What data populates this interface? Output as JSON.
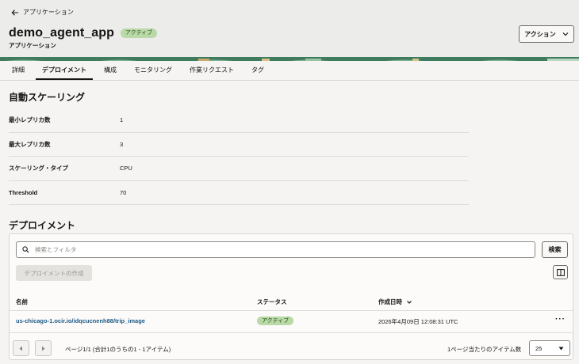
{
  "header": {
    "back_label": "アプリケーション",
    "title": "demo_agent_app",
    "status": "アクティブ",
    "subtitle": "アプリケーション",
    "action_label": "アクション"
  },
  "tabs": [
    {
      "label": "詳細"
    },
    {
      "label": "デプロイメント",
      "active": true
    },
    {
      "label": "構成"
    },
    {
      "label": "モニタリング"
    },
    {
      "label": "作業リクエスト"
    },
    {
      "label": "タグ"
    }
  ],
  "autoscaling": {
    "title": "自動スケーリング",
    "rows": [
      {
        "key": "最小レプリカ数",
        "value": "1"
      },
      {
        "key": "最大レプリカ数",
        "value": "3"
      },
      {
        "key": "スケーリング・タイプ",
        "value": "CPU"
      },
      {
        "key": "Threshold",
        "value": "70"
      }
    ]
  },
  "deployments": {
    "title": "デプロイメント",
    "search_placeholder": "検索とフィルタ",
    "search_button": "検索",
    "create_button": "デプロイメントの作成",
    "columns": {
      "name": "名前",
      "status": "ステータス",
      "created": "作成日時"
    },
    "rows": [
      {
        "name": "us-chicago-1.ocir.io/idqcucnenh88/trip_image",
        "status": "アクティブ",
        "created": "2026年4月09日 12:08:31 UTC"
      }
    ],
    "pager_text": "ページ1/1 (合計1のうちの1 - 1アイテム)",
    "per_page_label": "1ページ当たりのアイテム数",
    "per_page_value": "25"
  },
  "colors": {
    "accent_green": "#b9d9a6",
    "link": "#1c5a86",
    "band": "#3f7b5e"
  }
}
